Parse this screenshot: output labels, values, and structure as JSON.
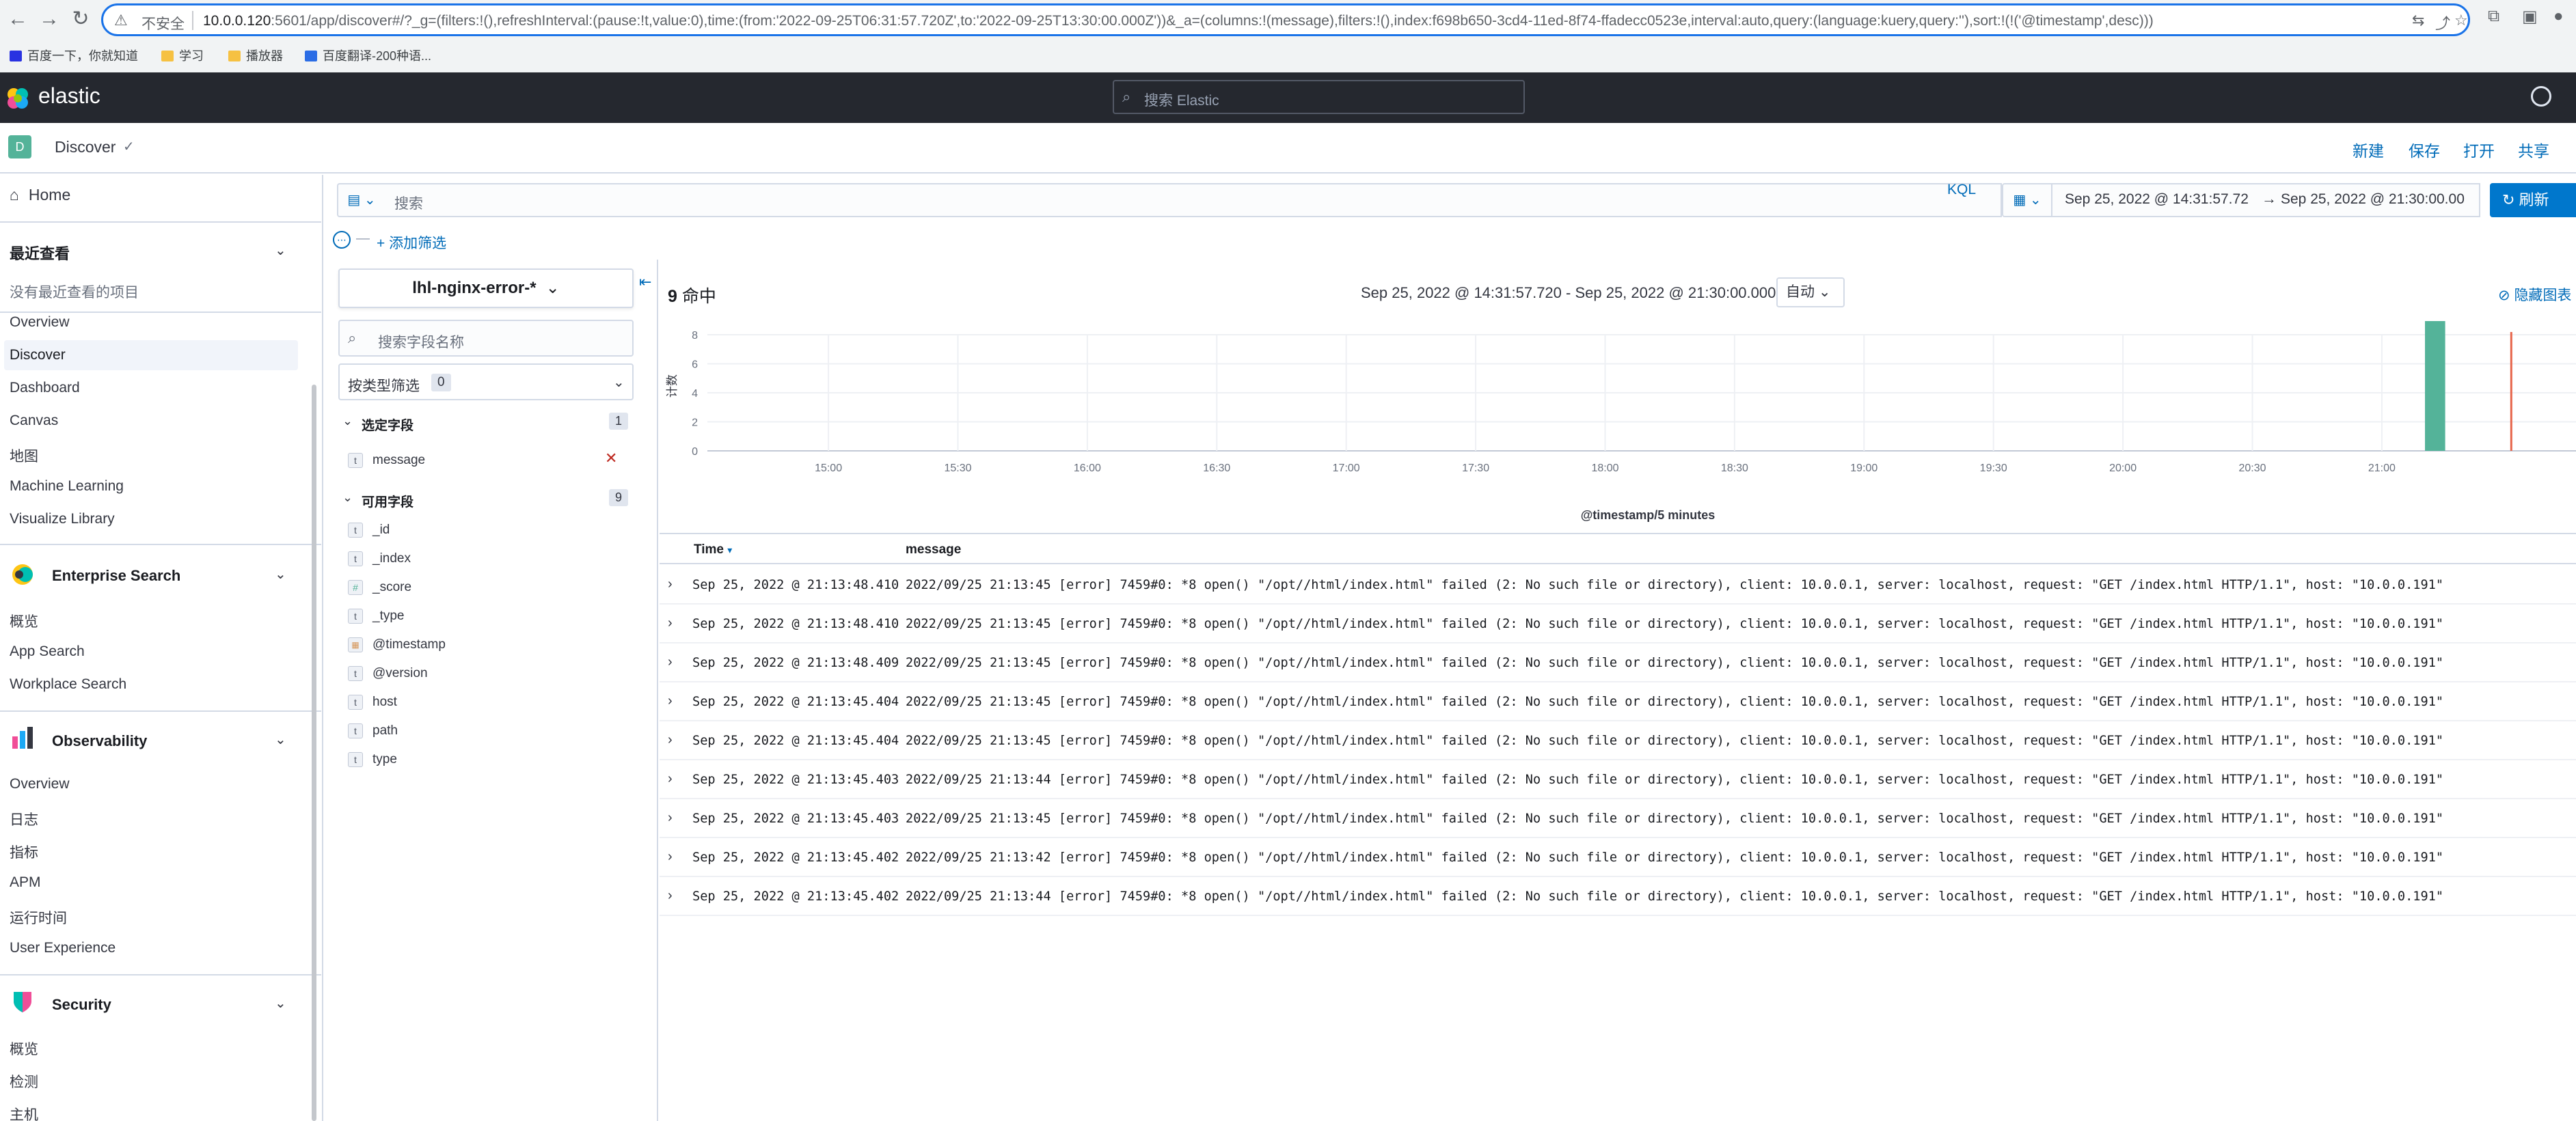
{
  "browser": {
    "insecure_label": "不安全",
    "url_host": "10.0.0.120",
    "url_rest": ":5601/app/discover#/?_g=(filters:!(),refreshInterval:(pause:!t,value:0),time:(from:'2022-09-25T06:31:57.720Z',to:'2022-09-25T13:30:00.000Z'))&_a=(columns:!(message),filters:!(),index:f698b650-3cd4-11ed-8f74-ffadecc0523e,interval:auto,query:(language:kuery,query:''),sort:!(!('@timestamp',desc)))",
    "bookmarks": [
      {
        "label": "百度一下，你就知道",
        "color": "#2932e1"
      },
      {
        "label": "学习",
        "color": "#f6c142"
      },
      {
        "label": "播放器",
        "color": "#f6c142"
      },
      {
        "label": "百度翻译-200种语...",
        "color": "#2b6de5"
      }
    ]
  },
  "header": {
    "brand": "elastic",
    "search_placeholder": "搜索 Elastic"
  },
  "breadcrumb": {
    "space_initial": "D",
    "app": "Discover",
    "actions": [
      "新建",
      "保存",
      "打开",
      "共享"
    ]
  },
  "nav": {
    "home": "Home",
    "recent_title": "最近查看",
    "recent_empty": "没有最近查看的项目",
    "analytics_items": [
      "Overview",
      "Discover",
      "Dashboard",
      "Canvas",
      "地图",
      "Machine Learning",
      "Visualize Library"
    ],
    "active_item": "Discover",
    "enterprise": {
      "title": "Enterprise Search",
      "items": [
        "概览",
        "App Search",
        "Workplace Search"
      ]
    },
    "observability": {
      "title": "Observability",
      "items": [
        "Overview",
        "日志",
        "指标",
        "APM",
        "运行时间",
        "User Experience"
      ]
    },
    "security": {
      "title": "Security",
      "items": [
        "概览",
        "检测",
        "主机"
      ]
    }
  },
  "query": {
    "placeholder": "搜索",
    "language": "KQL",
    "from": "Sep 25, 2022 @ 14:31:57.72",
    "to": "Sep 25, 2022 @ 21:30:00.00",
    "refresh_label": "刷新",
    "add_filter": "+ 添加筛选"
  },
  "sidebar": {
    "index_pattern": "lhl-nginx-error-*",
    "field_search_placeholder": "搜索字段名称",
    "type_filter_label": "按类型筛选",
    "type_filter_count": "0",
    "selected_title": "选定字段",
    "selected_count": "1",
    "selected_fields": [
      {
        "type": "t",
        "name": "message"
      }
    ],
    "available_title": "可用字段",
    "available_count": "9",
    "available_fields": [
      {
        "type": "t",
        "name": "_id"
      },
      {
        "type": "t",
        "name": "_index"
      },
      {
        "type": "#",
        "name": "_score"
      },
      {
        "type": "t",
        "name": "_type"
      },
      {
        "type": "date",
        "name": "@timestamp"
      },
      {
        "type": "t",
        "name": "@version"
      },
      {
        "type": "t",
        "name": "host"
      },
      {
        "type": "t",
        "name": "path"
      },
      {
        "type": "t",
        "name": "type"
      }
    ]
  },
  "results": {
    "hits_count": "9",
    "hits_label": "命中",
    "time_range": "Sep 25, 2022 @ 14:31:57.720 - Sep 25, 2022 @ 21:30:00.000",
    "interval": "自动",
    "hide_chart": "隐藏图表",
    "columns": {
      "time": "Time",
      "message": "message"
    },
    "rows": [
      {
        "time": "Sep 25, 2022 @ 21:13:48.410",
        "message": "2022/09/25 21:13:45 [error] 7459#0: *8 open() \"/opt//html/index.html\" failed (2: No such file or directory), client: 10.0.0.1, server: localhost, request: \"GET /index.html HTTP/1.1\", host: \"10.0.0.191\""
      },
      {
        "time": "Sep 25, 2022 @ 21:13:48.410",
        "message": "2022/09/25 21:13:45 [error] 7459#0: *8 open() \"/opt//html/index.html\" failed (2: No such file or directory), client: 10.0.0.1, server: localhost, request: \"GET /index.html HTTP/1.1\", host: \"10.0.0.191\""
      },
      {
        "time": "Sep 25, 2022 @ 21:13:48.409",
        "message": "2022/09/25 21:13:45 [error] 7459#0: *8 open() \"/opt//html/index.html\" failed (2: No such file or directory), client: 10.0.0.1, server: localhost, request: \"GET /index.html HTTP/1.1\", host: \"10.0.0.191\""
      },
      {
        "time": "Sep 25, 2022 @ 21:13:45.404",
        "message": "2022/09/25 21:13:45 [error] 7459#0: *8 open() \"/opt//html/index.html\" failed (2: No such file or directory), client: 10.0.0.1, server: localhost, request: \"GET /index.html HTTP/1.1\", host: \"10.0.0.191\""
      },
      {
        "time": "Sep 25, 2022 @ 21:13:45.404",
        "message": "2022/09/25 21:13:45 [error] 7459#0: *8 open() \"/opt//html/index.html\" failed (2: No such file or directory), client: 10.0.0.1, server: localhost, request: \"GET /index.html HTTP/1.1\", host: \"10.0.0.191\""
      },
      {
        "time": "Sep 25, 2022 @ 21:13:45.403",
        "message": "2022/09/25 21:13:44 [error] 7459#0: *8 open() \"/opt//html/index.html\" failed (2: No such file or directory), client: 10.0.0.1, server: localhost, request: \"GET /index.html HTTP/1.1\", host: \"10.0.0.191\""
      },
      {
        "time": "Sep 25, 2022 @ 21:13:45.403",
        "message": "2022/09/25 21:13:45 [error] 7459#0: *8 open() \"/opt//html/index.html\" failed (2: No such file or directory), client: 10.0.0.1, server: localhost, request: \"GET /index.html HTTP/1.1\", host: \"10.0.0.191\""
      },
      {
        "time": "Sep 25, 2022 @ 21:13:45.402",
        "message": "2022/09/25 21:13:42 [error] 7459#0: *8 open() \"/opt//html/index.html\" failed (2: No such file or directory), client: 10.0.0.1, server: localhost, request: \"GET /index.html HTTP/1.1\", host: \"10.0.0.191\""
      },
      {
        "time": "Sep 25, 2022 @ 21:13:45.402",
        "message": "2022/09/25 21:13:44 [error] 7459#0: *8 open() \"/opt//html/index.html\" failed (2: No such file or directory), client: 10.0.0.1, server: localhost, request: \"GET /index.html HTTP/1.1\", host: \"10.0.0.191\""
      }
    ]
  },
  "chart_data": {
    "type": "bar",
    "xlabel": "@timestamp/5 minutes",
    "ylabel": "计数",
    "x_ticks": [
      "15:00",
      "15:30",
      "16:00",
      "16:30",
      "17:00",
      "17:30",
      "18:00",
      "18:30",
      "19:00",
      "19:30",
      "20:00",
      "20:30",
      "21:00"
    ],
    "y_ticks": [
      0,
      2,
      4,
      6,
      8
    ],
    "ylim": [
      0,
      8
    ],
    "x_range": [
      "14:31:57",
      "21:30:00"
    ],
    "bars": [
      {
        "bucket": "21:10",
        "count": 9
      }
    ],
    "now_marker": "21:30",
    "bar_color": "#54b399",
    "marker_color": "#e7664c"
  }
}
